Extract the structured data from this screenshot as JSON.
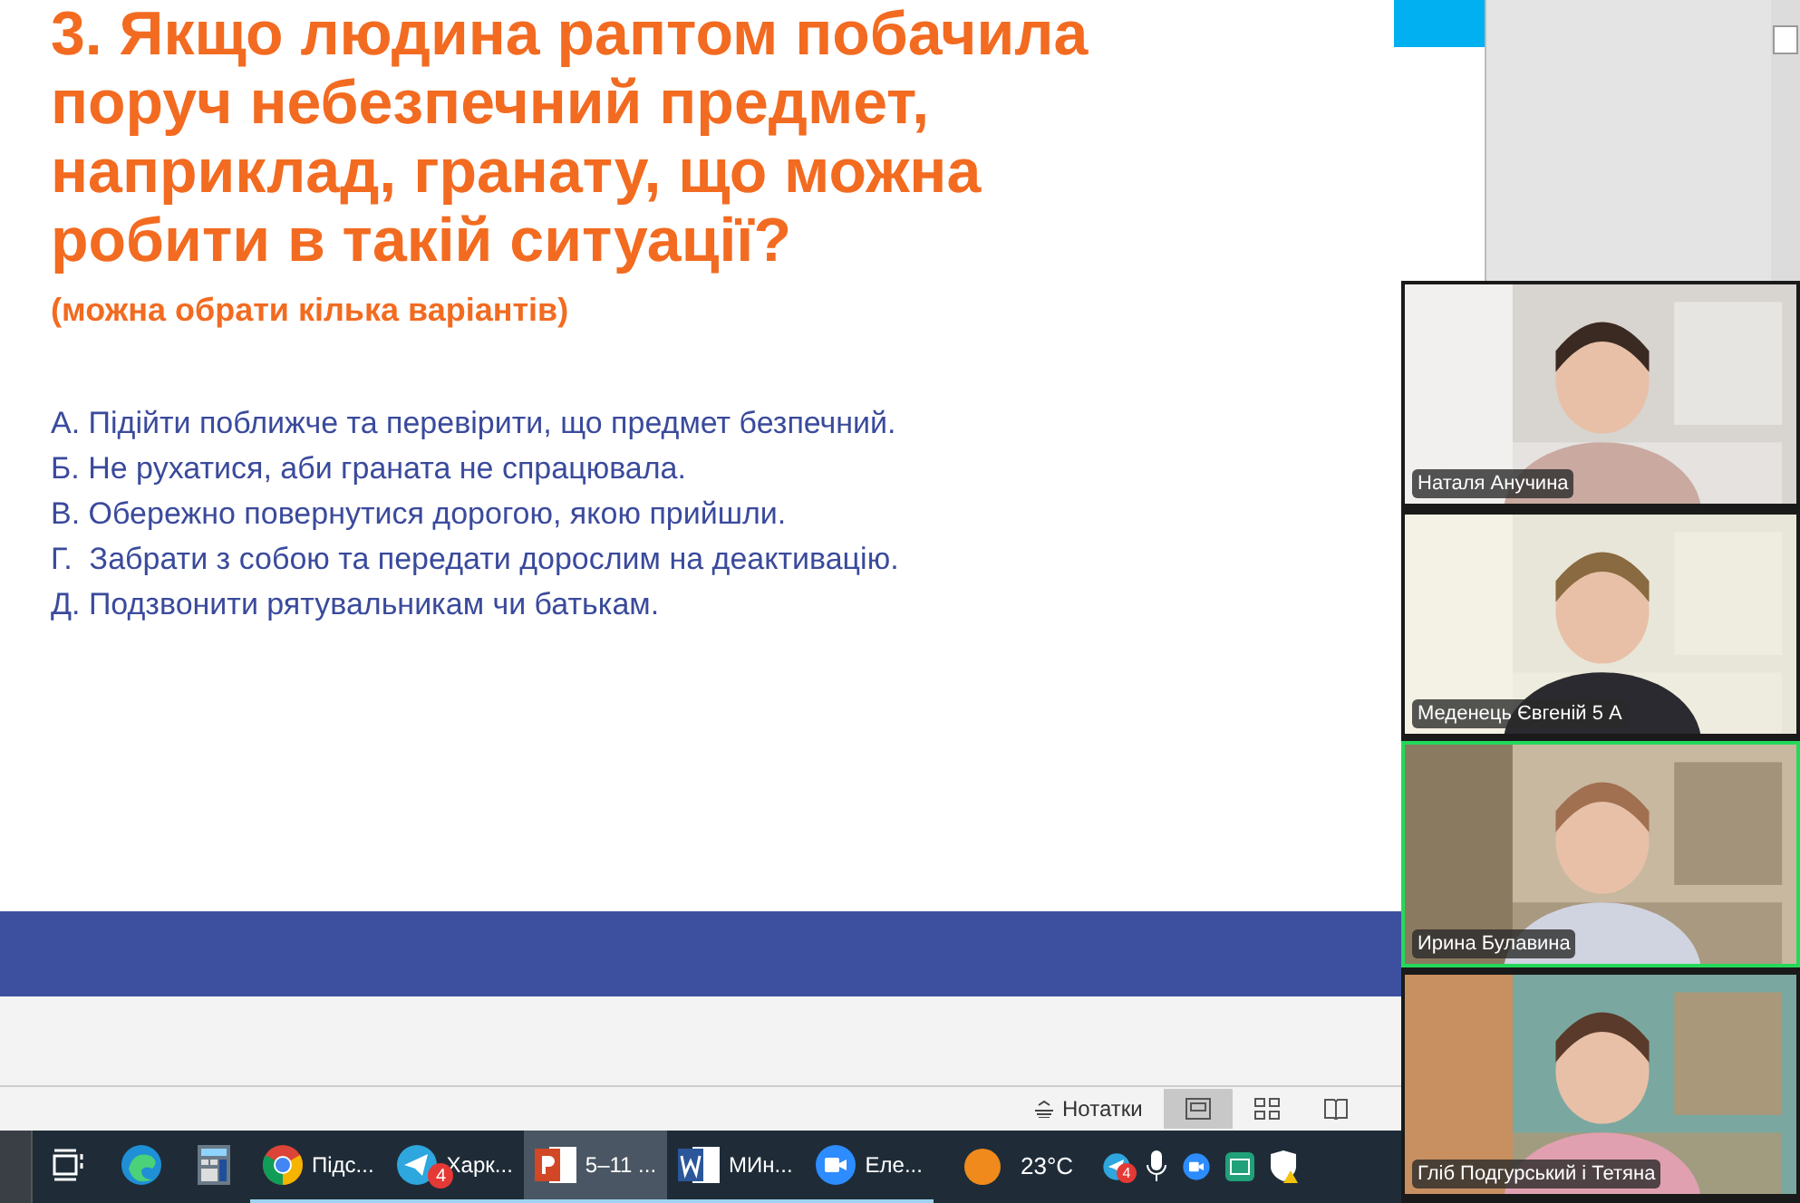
{
  "slide": {
    "title_lines": [
      "3. Якщо людина раптом побачила",
      "поруч небезпечний предмет,",
      "наприклад, гранату, що можна",
      "робити в такій ситуації?"
    ],
    "subtitle": "(можна обрати кілька варіантів)",
    "options": [
      "А. Підійти поближче та перевірити, що предмет безпечний.",
      "Б. Не рухатися, аби граната не спрацювала.",
      "В. Обережно повернутися дорогою, якою прийшли.",
      "Г.  Забрати з собою та передати дорослим на деактивацію.",
      "Д. Подзвонити рятувальникам чи батькам."
    ]
  },
  "status_bar": {
    "notes": "Нотатки",
    "views": [
      {
        "kind": "normal",
        "selected": true
      },
      {
        "kind": "sorter",
        "selected": false
      },
      {
        "kind": "reading",
        "selected": false
      }
    ]
  },
  "taskbar": {
    "apps": [
      {
        "kind": "taskview",
        "open": false,
        "active": false
      },
      {
        "kind": "edge",
        "open": false,
        "active": false
      },
      {
        "kind": "calculator",
        "open": false,
        "active": false
      },
      {
        "kind": "chrome",
        "label": "Підс...",
        "open": true,
        "active": false
      },
      {
        "kind": "telegram",
        "label": "Харк...",
        "badge": "4",
        "open": true,
        "active": false
      },
      {
        "kind": "powerpoint",
        "label": "5–11 ...",
        "open": true,
        "active": true
      },
      {
        "kind": "word",
        "label": "МИн...",
        "open": true,
        "active": false
      },
      {
        "kind": "zoom",
        "label": "Еле...",
        "open": true,
        "active": false
      }
    ],
    "weather": "23°C",
    "tray_badge": "4"
  },
  "participants": [
    {
      "name": "Наталя Анучина",
      "speaking": false
    },
    {
      "name": "Меденець Євгеній 5 А",
      "speaking": false
    },
    {
      "name": "Ирина Булавина",
      "speaking": true
    },
    {
      "name": "Гліб Подгурський і Тетяна",
      "speaking": false
    }
  ]
}
